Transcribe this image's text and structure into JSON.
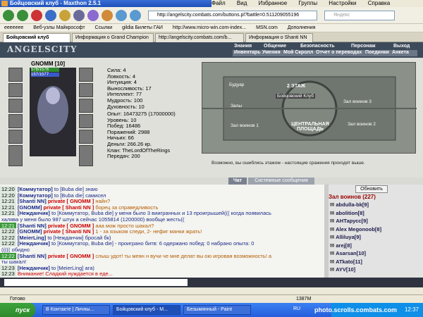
{
  "window": {
    "title": "Бойцовский клуб - Maxthon 2.5.1",
    "menus": [
      "Файл",
      "Вид",
      "Избранное",
      "Группы",
      "Настройки",
      "Справка"
    ]
  },
  "toolbar": {
    "address": "http://angelscity.combats.com/buttons.pl?battle=0.511209055196",
    "search_placeholder": "Яндекс"
  },
  "bookmarks": [
    "eeeeeee",
    "Веб-узлы Майкрософт",
    "Ссылки",
    "gildia Билеты ГАИ",
    "http://www.micro-win.com-index...",
    "MSN.com",
    "Дополнения"
  ],
  "tabs": [
    "Бойцовский клуб",
    "Информация о Grand Champion",
    "http://angelscity.combats.com/b...",
    "Информация о Shanti NN"
  ],
  "game": {
    "logo": "ANGELSCITY",
    "nav_top": [
      "Знания",
      "Общение",
      "Безопасность",
      "Персонаж",
      "Выход"
    ],
    "nav_bottom": [
      "Инвентарь",
      "Умения",
      "Мой Скролл",
      "Отчет о переводах",
      "Поединки",
      "Анкета"
    ]
  },
  "character": {
    "name": "GNOMM [10]",
    "hp": "576/1576",
    "mp": "157/1577",
    "stats": [
      "Сила: 4",
      "Ловкость: 4",
      "Интуиция: 4",
      "Выносливость: 17",
      "Интеллект: 77",
      "Мудрость: 100",
      "Духовность: 10"
    ],
    "stats2": [
      "Опыт: 16473275 (17000000)",
      "Уровень: 10",
      "Побед: 16486",
      "Поражений: 2988",
      "Ничьих: 66",
      "Деньги: 266.26 кр.",
      "Клан: TheLordOfTheRings",
      "Передач: 200"
    ],
    "map_labels": [
      "Будуар",
      "2 ЭТАЖ",
      "Бойцовский Клуб",
      "Залы",
      "Зал воинов 1",
      "Зал воинов 2",
      "Зал воинов 3",
      "ЦЕНТРАЛЬНАЯ ПЛОЩАДЬ"
    ],
    "map_caption": "Возможно, вы ошиблись этажом - настоящие сражения проходят выше."
  },
  "chat": {
    "tab_chat": "Чат",
    "tab_system": "Системные сообщения",
    "messages": [
      {
        "time": "12:20",
        "nick": "[Коммутатор]",
        "text": "to [Buba die] знаю"
      },
      {
        "time": "12:20",
        "nick": "[Коммутатор]",
        "text": "to [Buba die] самисел"
      },
      {
        "time": "12:21",
        "nick": "[Shanti NN]",
        "priv": "private [ GNOMM ]",
        "text": "найн?"
      },
      {
        "time": "12:21",
        "nick": "[GNOMM]",
        "priv": "private [ Shanti NN ]",
        "text": "борец за справедливость"
      },
      {
        "time": "12:21",
        "nick": "[Нежданчик]",
        "text": "to [Коммутатор, Buba die] у меня было 3 виигранных и 13 проигрышей((( когда появилась"
      },
      {
        "time": "",
        "nick": "",
        "text": "халява у меня было 987 штук а сейчас 1055814 (1200000) вообще жесть(("
      },
      {
        "time": "12:21",
        "nick": "[Shanti NN]",
        "priv": "private [ GNOMM ]",
        "text": "ааа мож просто шакал?",
        "hl": true
      },
      {
        "time": "12:22",
        "nick": "[GNOMM]",
        "priv": "private [ Shanti NN ]",
        "text": "1 - за языком следи, 2- нефиг манки жрать!"
      },
      {
        "time": "12:22",
        "nick": "[MeierLing]",
        "text": "to [Нежданчик] бросай бк)"
      },
      {
        "time": "12:22",
        "nick": "[Нежданчик]",
        "text": "to [Коммутатор, Buba die] - проиграно битв: 6 одержано побед: 0 набрано опыта: 0"
      },
      {
        "time": "",
        "nick": "",
        "text": "((((( обидно"
      },
      {
        "time": "12:22",
        "nick": "[Shanti NN]",
        "priv": "private [ GNOMM ]",
        "text": "слыш удот! ты меян н вучи че мне делат вы ою игровая возможность! а",
        "hl": true
      },
      {
        "time": "",
        "nick": "",
        "text": "ты шакал!"
      },
      {
        "time": "12:23",
        "nick": "[Нежданчик]",
        "text": "to [MeierLing] ага)"
      },
      {
        "time": "12:23",
        "nick": "",
        "text": "Внимание! Сладкий нуждается в еде...",
        "alert": true
      }
    ]
  },
  "userlist": {
    "refresh": "Обновить",
    "header": "Зал воинов (227)",
    "users": [
      "abdulla-bk[9]",
      "abolition[8]",
      "АНТарусс[9]",
      "Alex Megonoob[8]",
      "Alliluya[9]",
      "arej[8]",
      "Asarsan[10]",
      "ATkato[11]",
      "AYV[10]"
    ]
  },
  "status": {
    "left": "Готово",
    "right": "1387M"
  },
  "taskbar": {
    "start": "пуск",
    "tasks": [
      "В Контакте | Личны...",
      "Бойцовский клуб - M...",
      "Безымянный - Paint"
    ],
    "lang": "RU",
    "watermark": "photo.scrolls.combats.com",
    "clock": "12:37"
  },
  "colors": {
    "accent": "#245edb",
    "game_header": "#3d4a5a",
    "private": "#cc0000"
  }
}
